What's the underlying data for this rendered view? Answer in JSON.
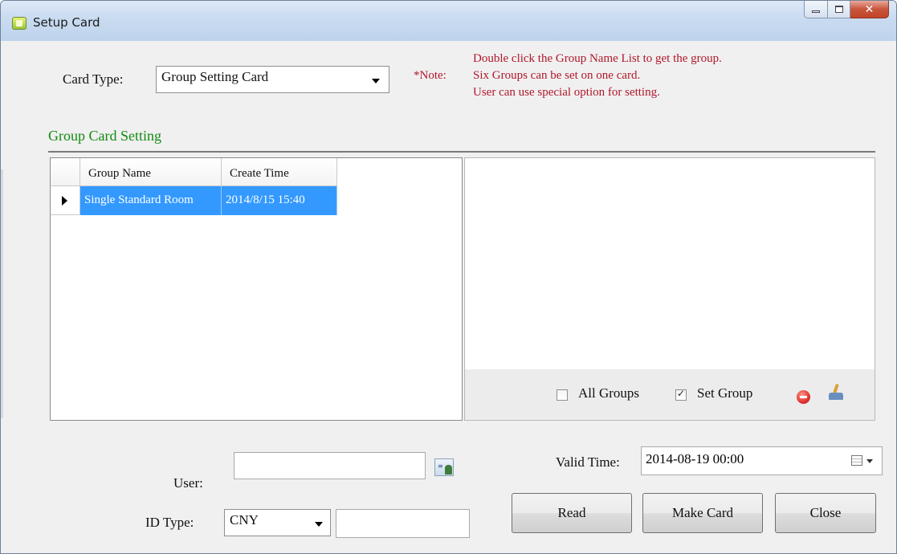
{
  "window": {
    "title": "Setup Card"
  },
  "card_type": {
    "label": "Card Type:",
    "selected": "Group Setting Card"
  },
  "note": {
    "label": "*Note:",
    "lines": [
      "Double click the Group Name List to get the group.",
      "Six Groups can be set on one card.",
      "User can use special option for setting."
    ]
  },
  "group_section": {
    "title": "Group Card Setting"
  },
  "grid": {
    "columns": [
      "Group Name",
      "Create Time"
    ],
    "rows": [
      {
        "group_name": "Single Standard Room",
        "create_time": "2014/8/15 15:40"
      }
    ]
  },
  "group_options": {
    "all_groups_label": "All Groups",
    "all_groups_checked": false,
    "set_group_label": "Set Group",
    "set_group_checked": true
  },
  "user": {
    "label": "User:",
    "value": ""
  },
  "id_type": {
    "label": "ID Type:",
    "selected": "CNY",
    "value": ""
  },
  "valid_time": {
    "label": "Valid Time:",
    "value": "2014-08-19 00:00"
  },
  "buttons": {
    "read": "Read",
    "make_card": "Make Card",
    "close": "Close"
  },
  "colors": {
    "note_red": "#b0182b",
    "section_green": "#138b13",
    "selection_blue": "#3399ff",
    "titlebar": "#c9dbf0"
  }
}
